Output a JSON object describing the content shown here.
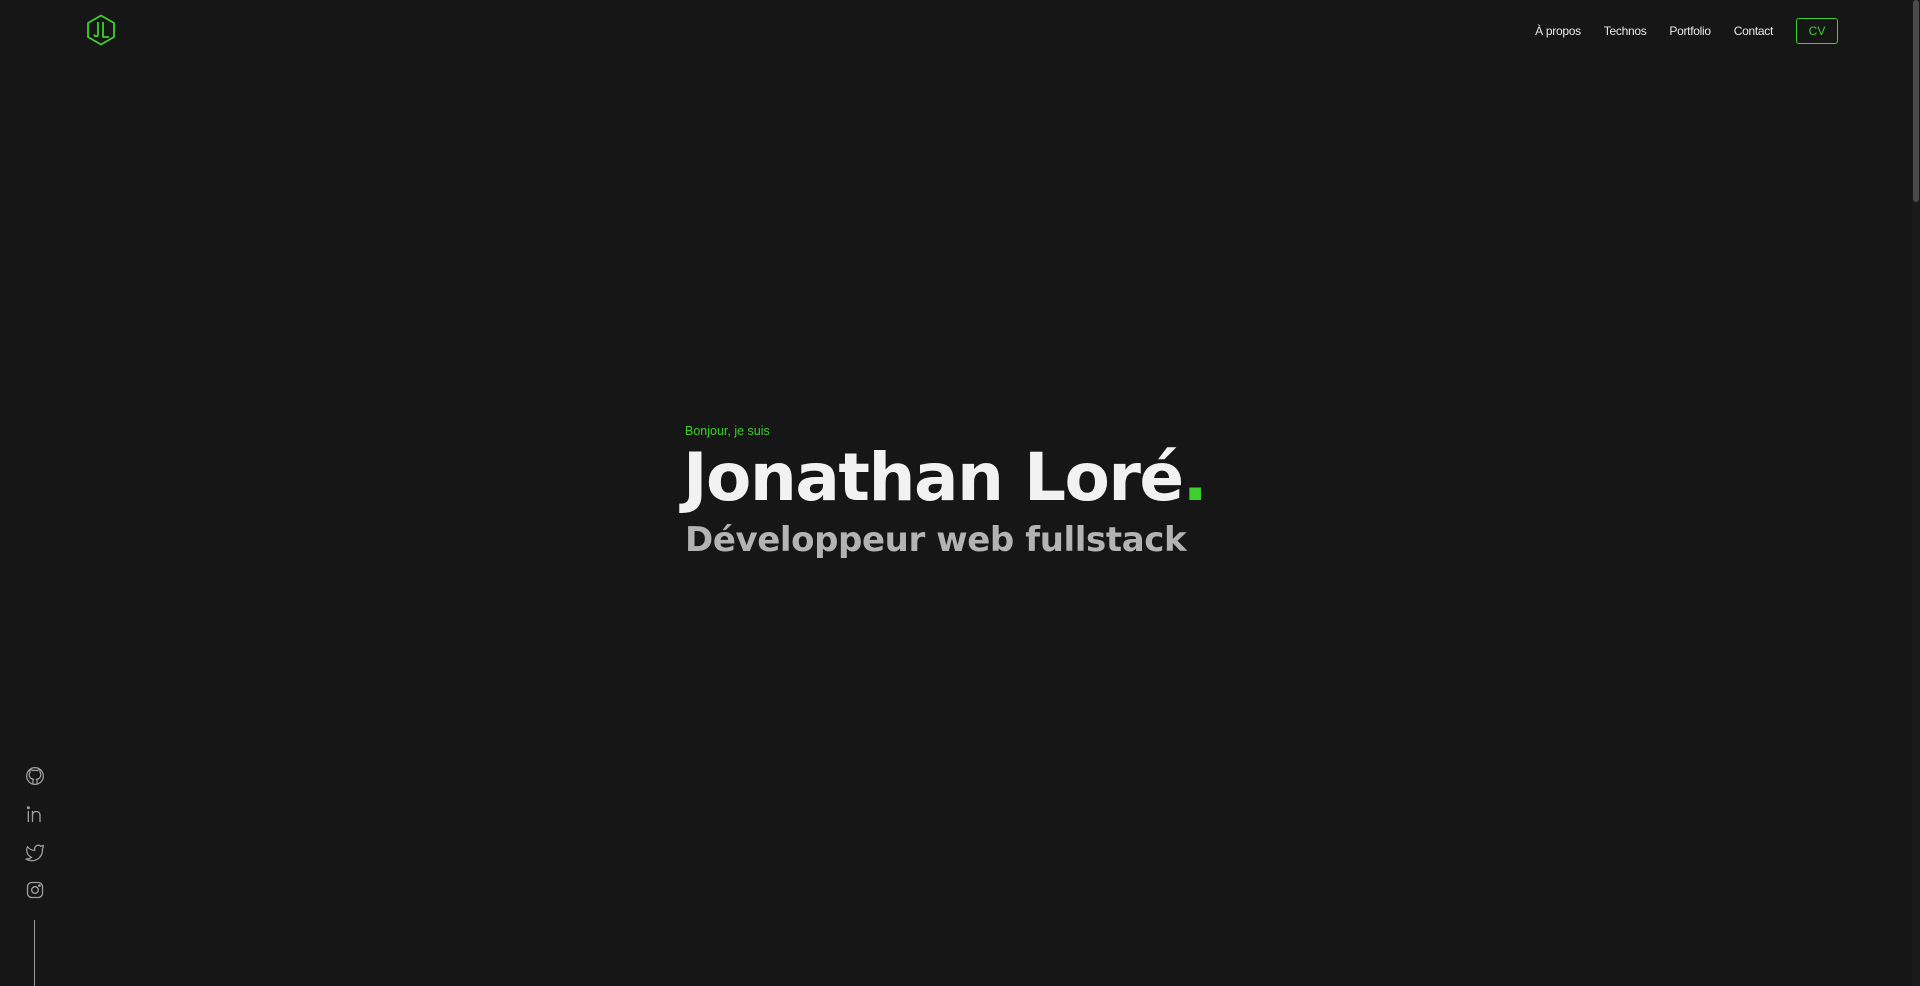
{
  "header": {
    "logo_icon": "jl-hexagon-logo-icon",
    "nav": [
      {
        "label": "À propos"
      },
      {
        "label": "Technos"
      },
      {
        "label": "Portfolio"
      },
      {
        "label": "Contact"
      }
    ],
    "cv_label": "CV"
  },
  "hero": {
    "greeting": "Bonjour, je suis",
    "name": "Jonathan Loré",
    "name_dot": ".",
    "role": "Développeur web fullstack"
  },
  "social": [
    {
      "icon": "github-icon"
    },
    {
      "icon": "linkedin-icon"
    },
    {
      "icon": "twitter-icon"
    },
    {
      "icon": "instagram-icon"
    }
  ],
  "colors": {
    "background": "#161616",
    "accent": "#3ed02d",
    "text": "#f2f2f2",
    "muted": "#b3b3b3"
  }
}
